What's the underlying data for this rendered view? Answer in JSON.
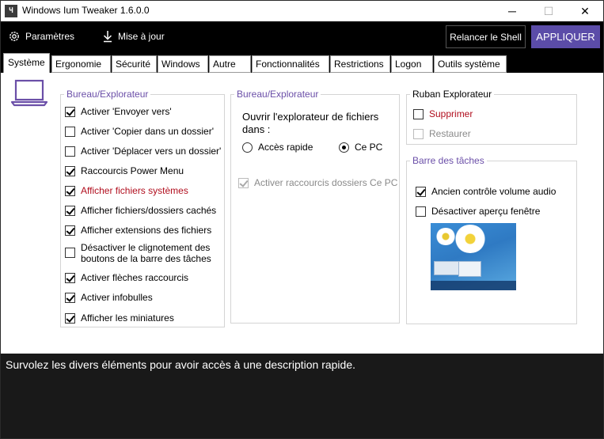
{
  "window": {
    "title": "Windows Ium Tweaker 1.6.0.0",
    "icon_text": "Ч",
    "minimize": "─",
    "maximize": "☐",
    "close": "✕"
  },
  "toolbar": {
    "settings_label": "Paramètres",
    "update_label": "Mise à jour",
    "relaunch_label": "Relancer le Shell",
    "apply_label": "APPLIQUER",
    "apply_color": "#5b4ca8"
  },
  "tabs": [
    {
      "label": "Système",
      "active": true
    },
    {
      "label": "Ergonomie"
    },
    {
      "label": "Sécurité"
    },
    {
      "label": "Windows"
    },
    {
      "label": "Autre"
    },
    {
      "label": "Fonctionnalités"
    },
    {
      "label": "Restrictions"
    },
    {
      "label": "Logon"
    },
    {
      "label": "Outils système"
    }
  ],
  "group_left": {
    "title": "Bureau/Explorateur",
    "items": [
      {
        "label": "Activer 'Envoyer vers'",
        "checked": true
      },
      {
        "label": "Activer 'Copier dans un dossier'",
        "checked": false
      },
      {
        "label": "Activer 'Déplacer vers un dossier'",
        "checked": false
      },
      {
        "label": "Raccourcis Power Menu",
        "checked": true
      },
      {
        "label": "Afficher fichiers systèmes",
        "checked": true,
        "color": "#b10e1e"
      },
      {
        "label": "Afficher fichiers/dossiers cachés",
        "checked": true
      },
      {
        "label": "Afficher extensions des fichiers",
        "checked": true
      },
      {
        "label": "Désactiver le clignotement des boutons de la barre des tâches",
        "checked": false
      },
      {
        "label": "Activer flèches raccourcis",
        "checked": true
      },
      {
        "label": "Activer infobulles",
        "checked": true
      },
      {
        "label": "Afficher les miniatures",
        "checked": true
      }
    ]
  },
  "group_mid": {
    "title": "Bureau/Explorateur",
    "open_label": "Ouvrir l'explorateur de fichiers dans :",
    "radio_quick": "Accès rapide",
    "radio_pc": "Ce PC",
    "selected": "Ce PC",
    "shortcuts_label": "Activer raccourcis dossiers Ce PC",
    "shortcuts_checked": true,
    "shortcuts_disabled": true
  },
  "group_ribbon": {
    "title": "Ruban Explorateur",
    "remove_label": "Supprimer",
    "remove_checked": false,
    "restore_label": "Restaurer",
    "restore_checked": false,
    "restore_disabled": true
  },
  "group_taskbar": {
    "title": "Barre des tâches",
    "volume_label": "Ancien contrôle volume audio",
    "volume_checked": true,
    "preview_label": "Désactiver aperçu fenêtre",
    "preview_checked": false
  },
  "status": {
    "text": "Survolez les divers éléments pour avoir accès à une description rapide."
  }
}
